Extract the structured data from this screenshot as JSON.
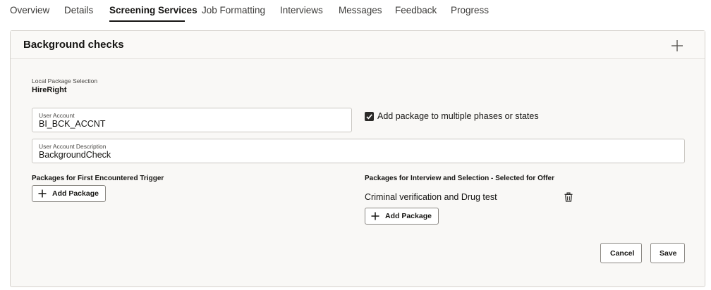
{
  "tabs": [
    {
      "label": "Overview"
    },
    {
      "label": "Details"
    },
    {
      "label": "Screening Services",
      "active": true
    },
    {
      "label": "Job Formatting"
    },
    {
      "label": "Interviews"
    },
    {
      "label": "Messages"
    },
    {
      "label": "Feedback"
    },
    {
      "label": "Progress"
    }
  ],
  "panel": {
    "title": "Background checks",
    "expand_icon": "plus-icon",
    "local_package": {
      "label": "Local Package Selection",
      "value": "HireRight"
    },
    "user_account": {
      "label": "User Account",
      "value": "BI_BCK_ACCNT"
    },
    "multi_phase": {
      "label": "Add package to multiple phases or states",
      "checked": true
    },
    "user_account_description": {
      "label": "User Account Description",
      "value": "BackgroundCheck"
    },
    "first_trigger": {
      "title": "Packages for First Encountered Trigger",
      "add_label": "Add Package"
    },
    "interview_selection": {
      "title": "Packages for Interview and Selection - Selected for Offer",
      "packages": [
        "Criminal verification and Drug test"
      ],
      "delete_icon": "trash-icon",
      "add_label": "Add Package"
    },
    "actions": {
      "cancel": "Cancel",
      "save": "Save"
    }
  },
  "colors": {
    "text": "#161513",
    "panel_bg": "#f9f8f6",
    "border": "#d6d3ce",
    "checkbox": "#2b2a28"
  }
}
